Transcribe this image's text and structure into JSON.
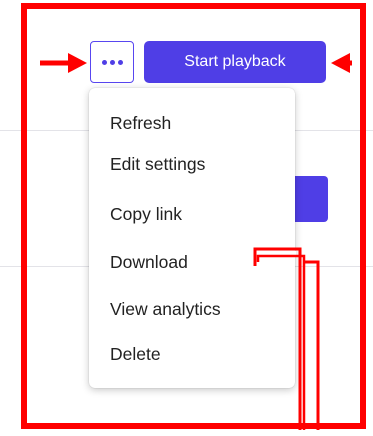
{
  "toolbar": {
    "primary_button_label": "Start playback",
    "more_button_icon": "more-horizontal-icon"
  },
  "menu": {
    "items": [
      {
        "label": "Refresh"
      },
      {
        "label": "Edit settings"
      },
      {
        "label": "Copy link"
      },
      {
        "label": "Download"
      },
      {
        "label": "View analytics"
      },
      {
        "label": "Delete"
      }
    ]
  },
  "annotation": {
    "color": "#ff0000",
    "highlighted_item": "Download"
  },
  "colors": {
    "accent": "#4f3ee6",
    "menu_text": "#222222",
    "divider": "#e3e3e8"
  }
}
